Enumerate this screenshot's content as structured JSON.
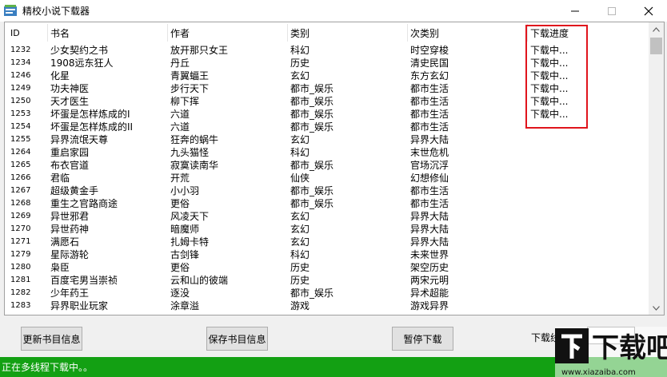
{
  "window": {
    "title": "精校小说下载器"
  },
  "list": {
    "columns": {
      "id": "ID",
      "name": "书名",
      "author": "作者",
      "category": "类别",
      "subcategory": "次类别",
      "progress": "下载进度"
    },
    "rows": [
      {
        "id": "1232",
        "name": "少女契约之书",
        "author": "放开那只女王",
        "category": "科幻",
        "subcategory": "时空穿梭",
        "progress": "下载中..."
      },
      {
        "id": "1234",
        "name": "1908远东狂人",
        "author": "丹丘",
        "category": "历史",
        "subcategory": "清史民国",
        "progress": "下载中..."
      },
      {
        "id": "1246",
        "name": "化星",
        "author": "青翼蝠王",
        "category": "玄幻",
        "subcategory": "东方玄幻",
        "progress": "下载中..."
      },
      {
        "id": "1249",
        "name": "功夫神医",
        "author": "步行天下",
        "category": "都市_娱乐",
        "subcategory": "都市生活",
        "progress": "下载中..."
      },
      {
        "id": "1250",
        "name": "天才医生",
        "author": "柳下挥",
        "category": "都市_娱乐",
        "subcategory": "都市生活",
        "progress": "下载中..."
      },
      {
        "id": "1253",
        "name": "坏蛋是怎样炼成的I",
        "author": "六道",
        "category": "都市_娱乐",
        "subcategory": "都市生活",
        "progress": "下载中..."
      },
      {
        "id": "1254",
        "name": "坏蛋是怎样炼成的II",
        "author": "六道",
        "category": "都市_娱乐",
        "subcategory": "都市生活",
        "progress": ""
      },
      {
        "id": "1255",
        "name": "异界流氓天尊",
        "author": "狂奔的蜗牛",
        "category": "玄幻",
        "subcategory": "异界大陆",
        "progress": ""
      },
      {
        "id": "1264",
        "name": "重启家园",
        "author": "九头猫怪",
        "category": "科幻",
        "subcategory": "末世危机",
        "progress": ""
      },
      {
        "id": "1265",
        "name": "布衣官道",
        "author": "寂寞读南华",
        "category": "都市_娱乐",
        "subcategory": "官场沉浮",
        "progress": ""
      },
      {
        "id": "1266",
        "name": "君临",
        "author": "开荒",
        "category": "仙侠",
        "subcategory": "幻想修仙",
        "progress": ""
      },
      {
        "id": "1267",
        "name": "超级黄金手",
        "author": "小小羽",
        "category": "都市_娱乐",
        "subcategory": "都市生活",
        "progress": ""
      },
      {
        "id": "1268",
        "name": "重生之官路商途",
        "author": "更俗",
        "category": "都市_娱乐",
        "subcategory": "都市生活",
        "progress": ""
      },
      {
        "id": "1269",
        "name": "异世邪君",
        "author": "风凌天下",
        "category": "玄幻",
        "subcategory": "异界大陆",
        "progress": ""
      },
      {
        "id": "1270",
        "name": "异世药神",
        "author": "暗魔师",
        "category": "玄幻",
        "subcategory": "异界大陆",
        "progress": ""
      },
      {
        "id": "1271",
        "name": "满愿石",
        "author": "扎姆卡特",
        "category": "玄幻",
        "subcategory": "异界大陆",
        "progress": ""
      },
      {
        "id": "1279",
        "name": "星际游轮",
        "author": "古剑锋",
        "category": "科幻",
        "subcategory": "未来世界",
        "progress": ""
      },
      {
        "id": "1280",
        "name": "枭臣",
        "author": "更俗",
        "category": "历史",
        "subcategory": "架空历史",
        "progress": ""
      },
      {
        "id": "1281",
        "name": "百度宅男当崇祯",
        "author": "云和山的彼端",
        "category": "历史",
        "subcategory": "两宋元明",
        "progress": ""
      },
      {
        "id": "1282",
        "name": "少年药王",
        "author": "逐没",
        "category": "都市_娱乐",
        "subcategory": "异术超能",
        "progress": ""
      },
      {
        "id": "1283",
        "name": "异界职业玩家",
        "author": "涂章溢",
        "category": "游戏",
        "subcategory": "游戏异界",
        "progress": ""
      }
    ]
  },
  "buttons": {
    "refresh": "更新书目信息",
    "save": "保存书目信息",
    "pause": "暂停下载"
  },
  "thread_label": "下载线程数",
  "status": "正在多线程下载中。。",
  "watermark": {
    "text": "下载吧",
    "url": "www.xiazaiba.com"
  },
  "colors": {
    "status_bar": "#13a013",
    "highlight": "#e0141c"
  }
}
